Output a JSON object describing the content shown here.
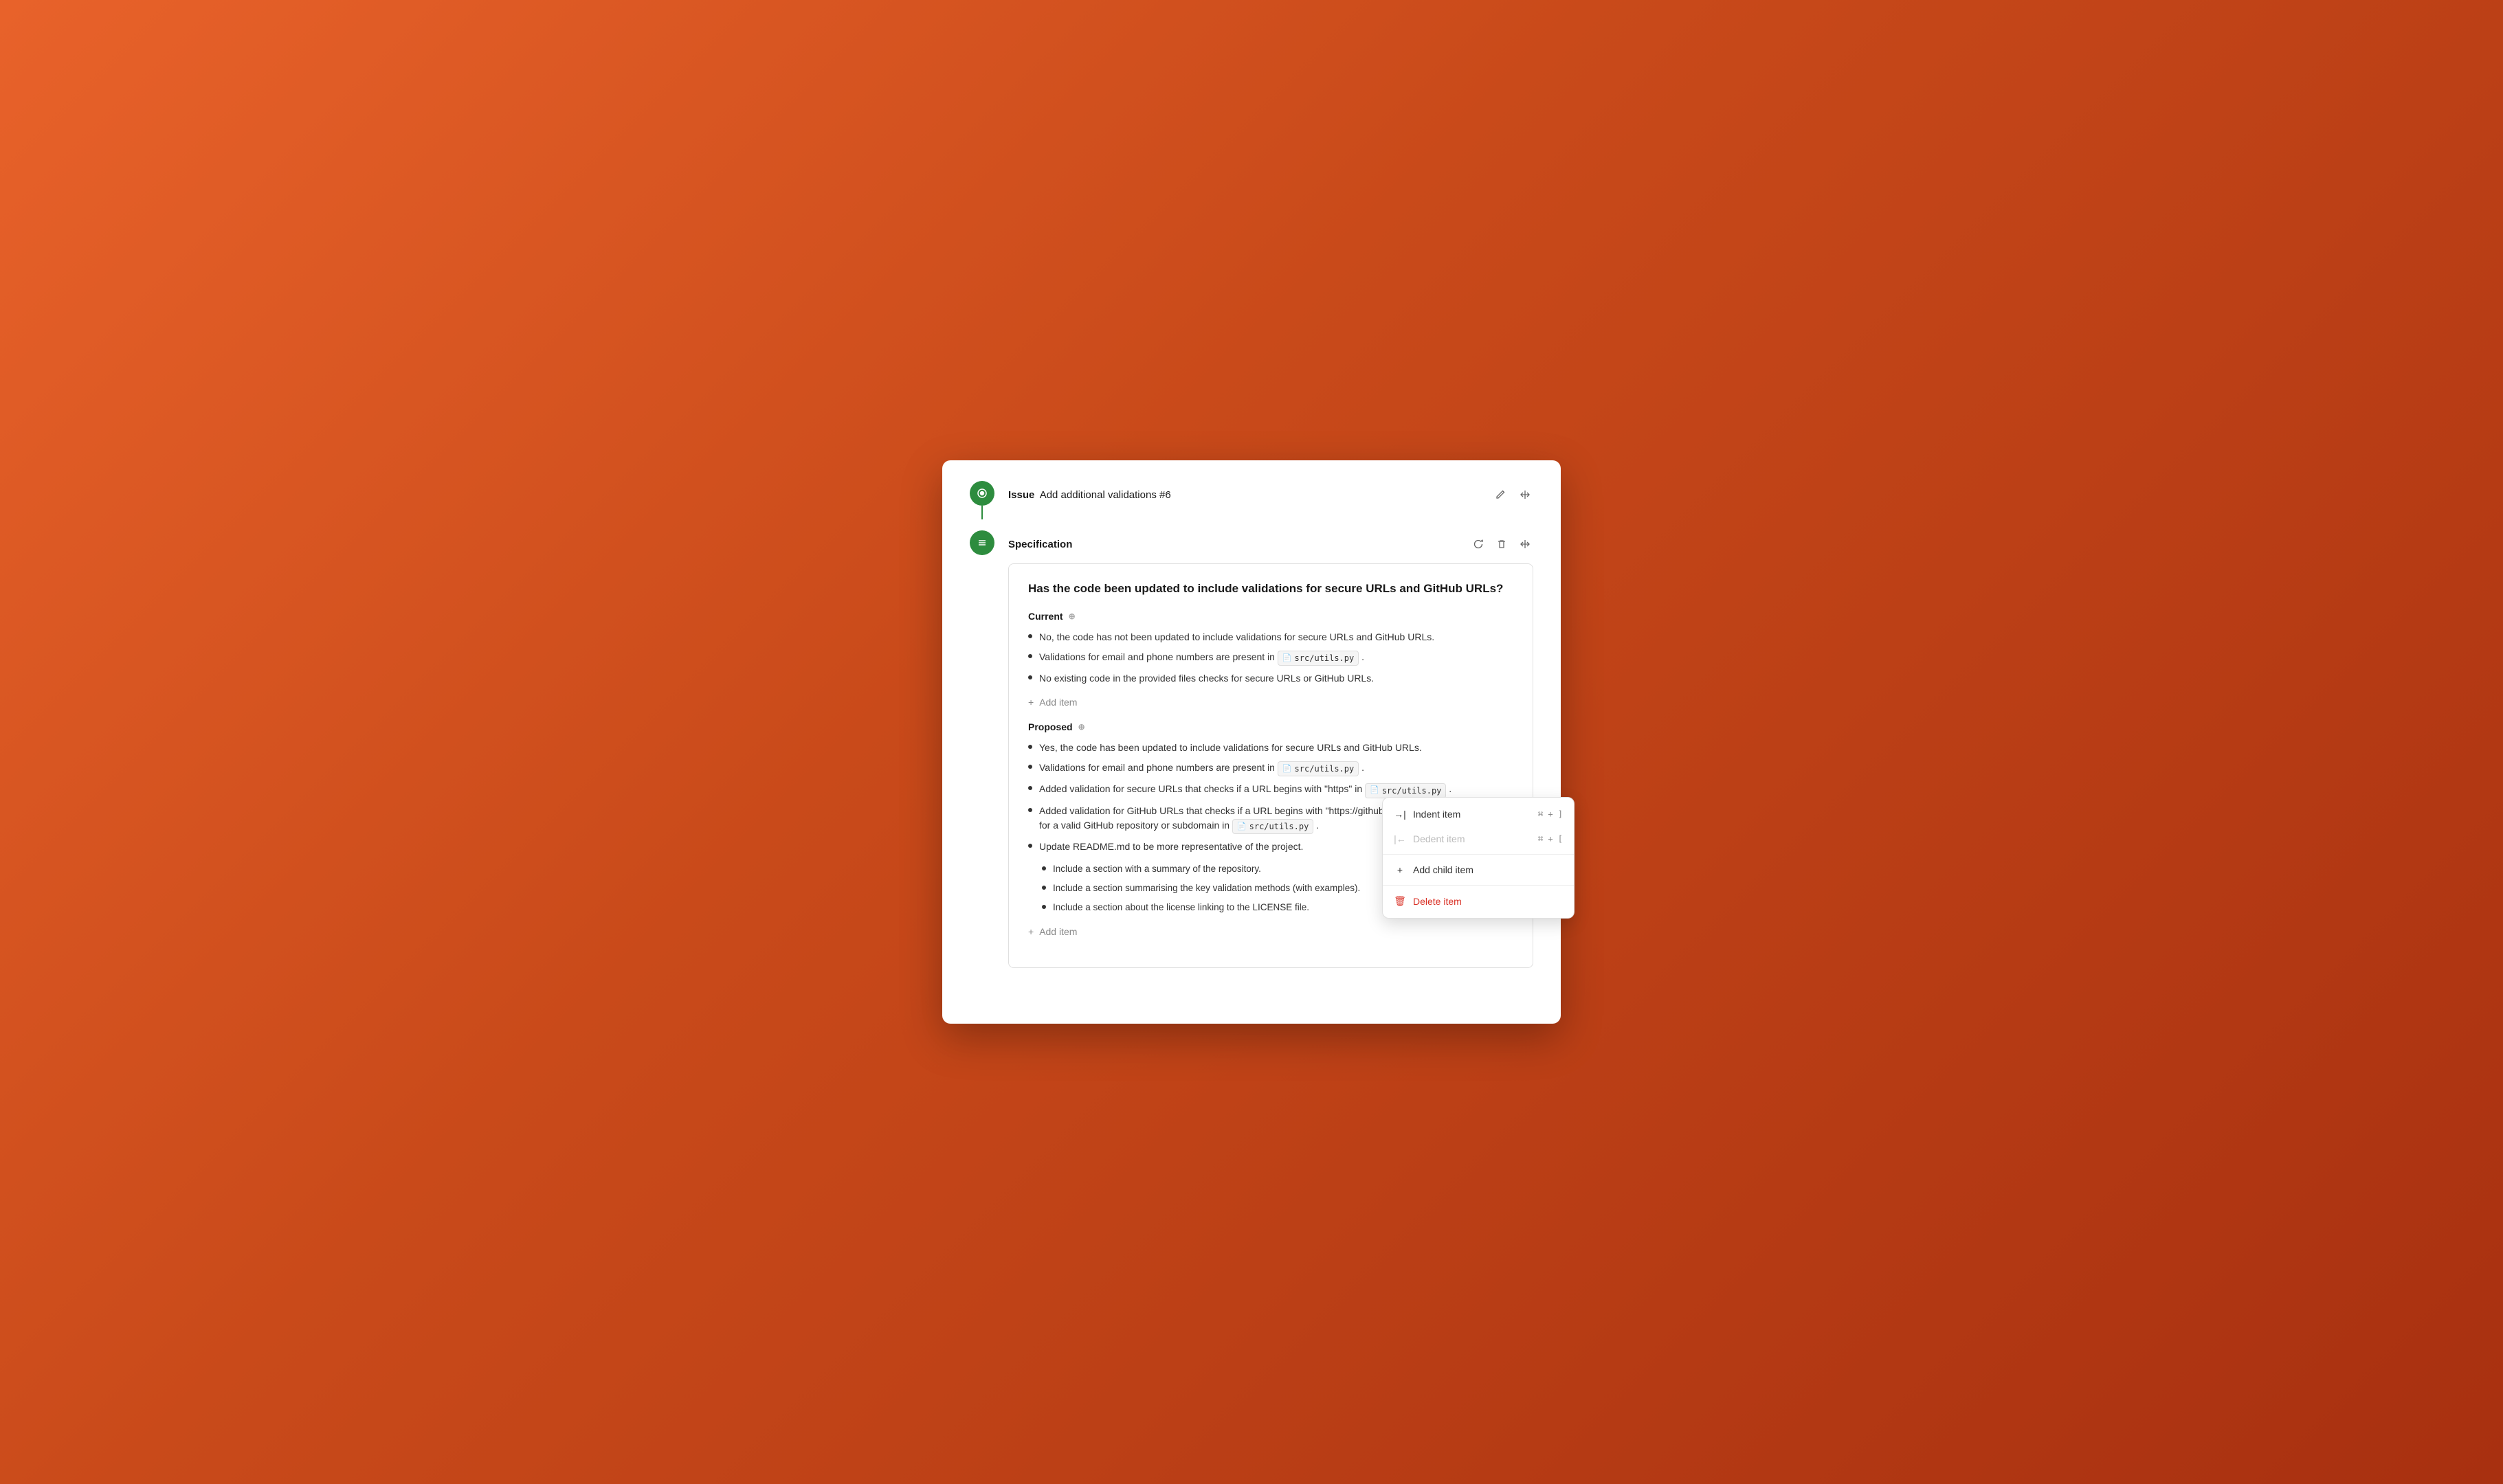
{
  "window": {
    "title": "Issue Specification"
  },
  "issue": {
    "label": "Issue",
    "title": "Add additional validations #6",
    "edit_icon": "pencil",
    "move_icon": "arrows"
  },
  "specification": {
    "label": "Specification",
    "refresh_icon": "refresh",
    "delete_icon": "trash",
    "move_icon": "arrows"
  },
  "card": {
    "main_title": "Has the code been updated to include validations for secure URLs and GitHub URLs?",
    "current_section": {
      "label": "Current",
      "items": [
        "No, the code has not been updated to include validations for secure URLs and GitHub URLs.",
        "Validations for email and phone numbers are present in src/utils.py .",
        "No existing code in the provided files checks for secure URLs or GitHub URLs."
      ],
      "code_tags": [
        1
      ],
      "add_item_label": "Add item"
    },
    "proposed_section": {
      "label": "Proposed",
      "items": [
        "Yes, the code has been updated to include validations for secure URLs and GitHub URLs.",
        "Validations for email and phone numbers are present in src/utils.py .",
        "Added validation for secure URLs that checks if a URL begins with \"https\" in src/utils.py .",
        "Added validation for GitHub URLs that checks if a URL begins with \"https://github.com\" and follows the format for a valid GitHub repository or subdomain in src/utils.py .",
        "Update README.md to be more representative of the project."
      ],
      "nested_items": [
        "Include a section with a summary of the repository.",
        "Include a section summarising the key validation methods (with examples).",
        "Include a section about the license linking to the LICENSE file."
      ],
      "add_item_label": "Add item"
    }
  },
  "context_menu": {
    "indent_label": "Indent item",
    "indent_shortcut": "⌘ + ]",
    "dedent_label": "Dedent item",
    "dedent_shortcut": "⌘ + [",
    "add_child_label": "Add child item",
    "delete_label": "Delete item"
  },
  "colors": {
    "green": "#2d8c3e",
    "danger": "#d93025"
  }
}
